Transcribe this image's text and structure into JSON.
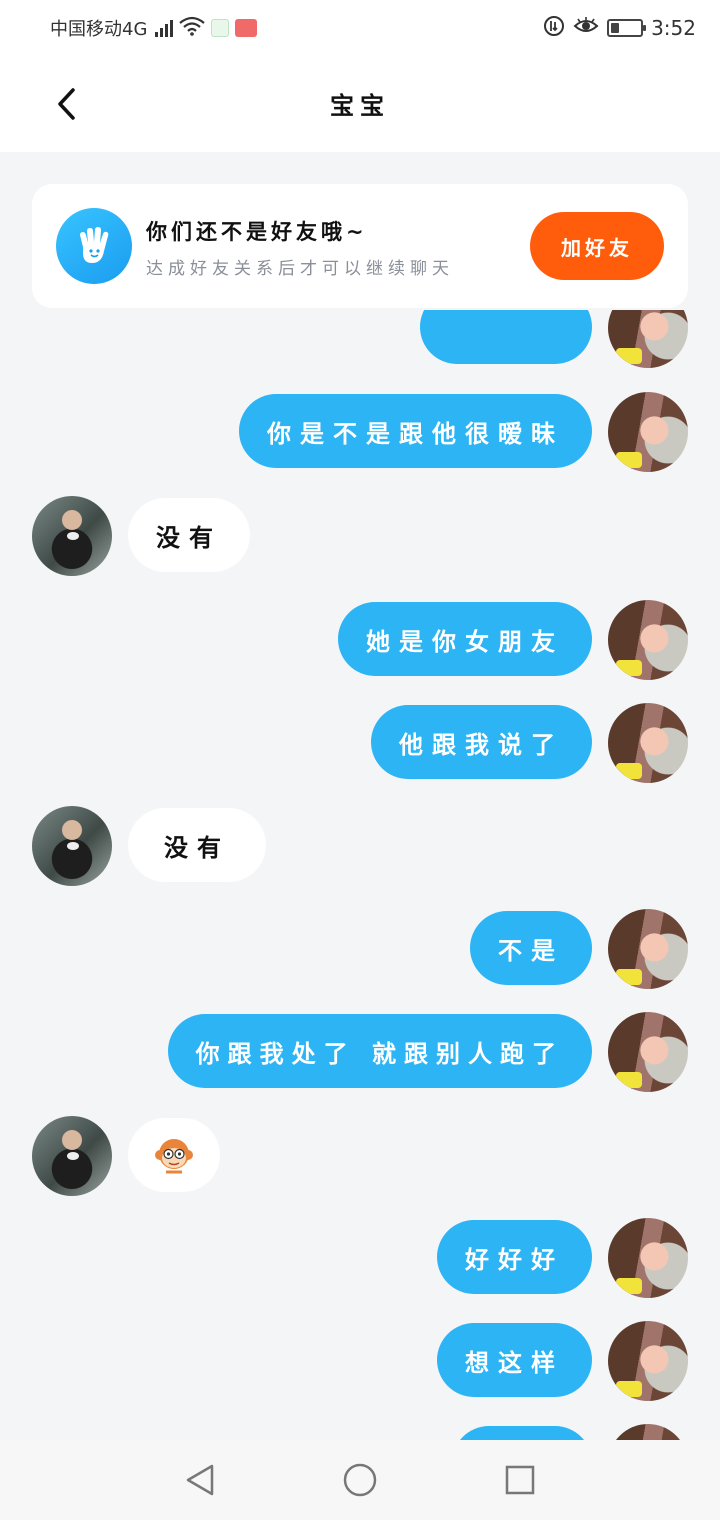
{
  "statusbar": {
    "carrier": "中国移动4G",
    "network_sup": "4G",
    "time": "3:52",
    "battery_level": 0.25,
    "icons": [
      "signal-icon",
      "wifi-icon",
      "shield-icon",
      "app-notification-icon",
      "data-saver-icon",
      "eye-icon",
      "battery-icon"
    ]
  },
  "header": {
    "title": "宝宝",
    "back_icon": "chevron-left-icon"
  },
  "friend_banner": {
    "icon": "hand-wave-icon",
    "title": "你们还不是好友哦~",
    "subtitle": "达成好友关系后才可以继续聊天",
    "button_label": "加好友"
  },
  "messages": [
    {
      "side": "me",
      "text": ""
    },
    {
      "side": "me",
      "text": "你是不是跟他很暧昧"
    },
    {
      "side": "peer",
      "text": "没有"
    },
    {
      "side": "me",
      "text": "她是你女朋友"
    },
    {
      "side": "me",
      "text": "他跟我说了"
    },
    {
      "side": "peer",
      "text": "没有"
    },
    {
      "side": "me",
      "text": "不是"
    },
    {
      "side": "me",
      "text": "你跟我处了 就跟别人跑了"
    },
    {
      "side": "peer",
      "text": "",
      "emoji": "monkey-sticker-icon"
    },
    {
      "side": "me",
      "text": "好好好"
    },
    {
      "side": "me",
      "text": "想这样"
    },
    {
      "side": "me",
      "text": ""
    }
  ],
  "navbar": {
    "back_icon": "triangle-back-icon",
    "home_icon": "circle-home-icon",
    "recents_icon": "square-recents-icon"
  },
  "colors": {
    "accent_blue": "#2cb4f5",
    "button_orange": "#ff5d0c",
    "background": "#f4f5f7"
  }
}
